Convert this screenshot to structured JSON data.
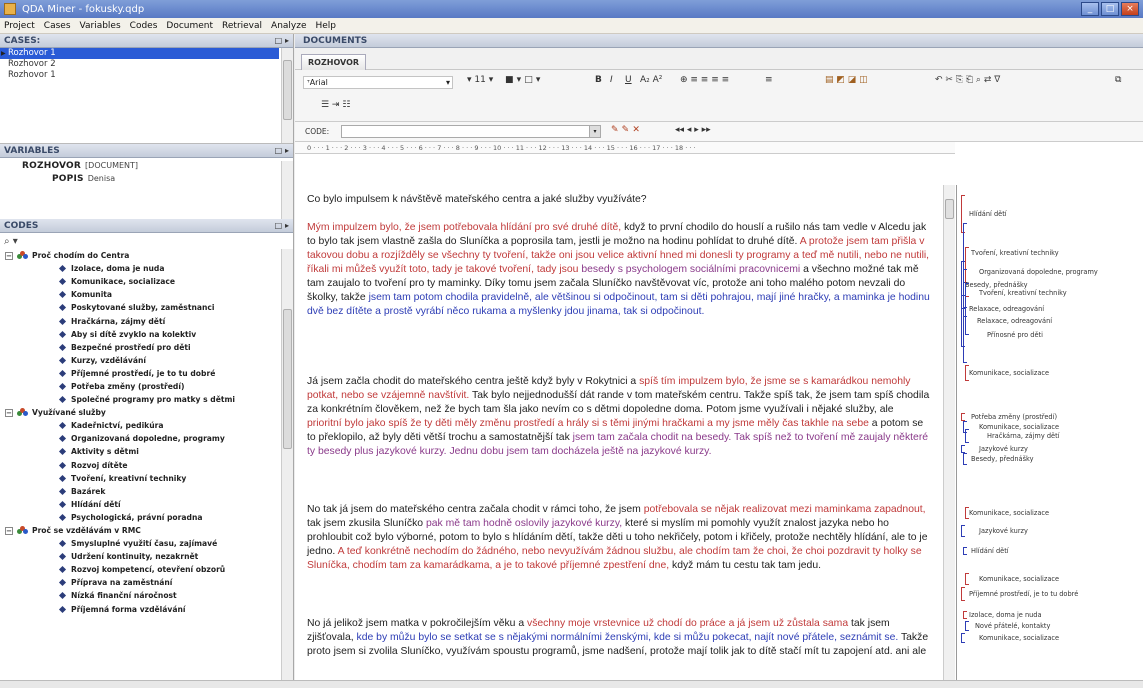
{
  "window": {
    "title": "QDA Miner - fokusky.qdp"
  },
  "menu": [
    "Project",
    "Cases",
    "Variables",
    "Codes",
    "Document",
    "Retrieval",
    "Analyze",
    "Help"
  ],
  "cases": {
    "header": "CASES:",
    "pin": "□ ▸",
    "items": [
      "Rozhovor 1",
      "Rozhovor 2",
      "Rozhovor 1"
    ]
  },
  "variables": {
    "header": "VARIABLES",
    "pin": "□ ▸",
    "rows": [
      {
        "name": "ROZHOVOR",
        "value": "[DOCUMENT]"
      },
      {
        "name": "POPIS",
        "value": "Denisa"
      }
    ]
  },
  "codes": {
    "header": "CODES",
    "pin": "□ ▸",
    "search_icon": "⌕ ▾",
    "groups": [
      {
        "label": "Proč chodím do Centra",
        "children": [
          "Izolace, doma je nuda",
          "Komunikace, socializace",
          "Komunita",
          "Poskytované služby, zaměstnanci",
          "Hračkárna, zájmy dětí",
          "Aby si dítě zvyklo na kolektiv",
          "Bezpečné prostředí pro děti",
          "Kurzy, vzdělávání",
          "Příjemné prostředí, je to tu dobré",
          "Potřeba změny (prostředí)",
          "Společné programy pro matky s dětmi"
        ]
      },
      {
        "label": "Využívané služby",
        "children": [
          "Kadeřnictví, pedikúra",
          "Organizovaná dopoledne, programy",
          "Aktivity s dětmi",
          "Rozvoj dítěte",
          "Tvoření, kreativní techniky",
          "Bazárek",
          "Hlídání dětí",
          "Psychologická, právní poradna"
        ]
      },
      {
        "label": "Proč se vzdělávám v RMC",
        "children": [
          "Smysluplné využití času, zajímavé",
          "Udržení kontinuity, nezakrnět",
          "Rozvoj kompetencí, otevření obzorů",
          "Příprava na zaměstnání",
          "Nízká finanční náročnost",
          "Příjemná forma vzdělávání"
        ]
      }
    ]
  },
  "documents": {
    "header": "DOCUMENTS",
    "tab": "ROZHOVOR",
    "font": "Arial",
    "font_size": "11",
    "code_label": "CODE:",
    "ruler": "0 · · · 1 · · · 2 · · · 3 · · · 4 · · · 5 · · · 6 · · · 7 · · · 8 · · · 9 · · · 10 · · · 11 · · · 12 · · · 13 · · · 14 · · · 15 · · · 16 · · · 17 · · · 18 · · ·"
  },
  "text": {
    "q": "Co bylo impulsem k návštěvě mateřského centra a jaké služby využíváte?",
    "p1a": "Mým impulzem bylo, že jsem potřebovala hlídání pro své druhé dítě,",
    "p1b": " když to první chodilo do houslí a rušilo nás tam vedle v Alcedu jak to bylo tak jsem vlastně zašla do Sluníčka a poprosila tam, jestli je možno na hodinu pohlídat to druhé dítě. ",
    "p1c": "A protože jsem tam přišla v takovou dobu a rozjížděly se všechny ty tvoření, takže oni jsou velice aktivní hned mi donesli ty programy a teď mě nutili, nebo ne nutili, říkali mi můžeš využít toto, tady je takové tvoření, tady jsou",
    "p1d": " besedy s psychologem sociálními pracovnicemi",
    "p1e": " a všechno možné tak mě tam zaujalo to tvoření pro ty maminky. Díky tomu jsem začala Sluníčko navštěvovat víc, protože ani toho malého potom nevzali do školky, takže ",
    "p1f": "jsem tam potom chodila pravidelně, ale většinou si odpočinout, tam si děti pohrajou, mají jiné hračky, a maminka je hodinu dvě bez dítěte a prostě vyrábí něco rukama a myšlenky jdou jinama, tak si odpočinout.",
    "p2a": "Já jsem začla chodit do mateřského centra ještě když byly v Rokytnici a ",
    "p2b": "spíš tím impulzem bylo, že jsme se s kamarádkou nemohly potkat, nebo se vzájemně navštívit.",
    "p2c": " Tak bylo nejjednodušší dát rande v tom mateřském centru. Takže spíš tak, že jsem tam spíš chodila za konkrétním člověkem, než že bych tam šla jako nevím co s dětmi dopoledne doma. Potom jsme využívali i nějaké služby, ale ",
    "p2d": "prioritní bylo jako spíš že ty děti měly změnu prostředí a hrály si s těmi jinými hračkami a my jsme měly čas takhle na sebe",
    "p2e": " a potom se to překlopilo, až byly děti větší trochu a samostatnější tak ",
    "p2f": "jsem tam začala chodit na besedy. Tak spíš než to tvoření mě zaujaly některé ty besedy plus jazykové kurzy. Jednu dobu jsem tam docházela ještě na jazykové kurzy.",
    "p3a": "No tak já jsem do mateřského centra začala chodit v rámci toho, že jsem ",
    "p3b": "potřebovala se nějak realizovat mezi maminkama zapadnout,",
    "p3c": " tak jsem zkusila Sluníčko ",
    "p3d": "pak mě tam hodně oslovily jazykové kurzy,",
    "p3e": " které si myslím mi pomohly využít znalost jazyka nebo ho prohloubit což bylo výborné, potom to bylo s hlídáním dětí, takže děti u toho nekřičely, potom i křičely, protože nechtěly hlídání, ale to je jedno. ",
    "p3f": "A teď konkrétně nechodím do žádného, nebo nevyužívám žádnou službu, ale chodím tam že choi, že choi pozdravit ty holky se Sluníčka, chodím tam za kamarádkama, a je to takové příjemné zpestření dne,",
    "p3g": " když mám tu cestu tak tam jedu.",
    "p4a": "No já jelikož jsem matka v pokročilejším věku a ",
    "p4b": "všechny moje vrstevnice už chodí do práce a já jsem už zůstala sama",
    "p4c": " tak jsem zjišťovala, ",
    "p4d": "kde by můžu bylo se setkat se s nějakými normálními ženskými, kde si můžu pokecat, najít nové přátele, seznámit se.",
    "p4e": " Takže proto jsem si zvolila Sluníčko, využívám spoustu programů, jsme nadšení, protože mají tolik jak to dítě stačí mít tu zapojení atd. ani ale"
  },
  "annotations": [
    "Hlídání dětí",
    "Tvoření, kreativní techniky",
    "Organizovaná dopoledne, programy",
    "Besedy, přednášky",
    "Tvoření, kreativní techniky",
    "Relaxace, odreagování",
    "Relaxace, odreagování",
    "Přínosné pro děti",
    "Komunikace, socializace",
    "Potřeba změny (prostředí)",
    "Komunikace, socializace",
    "Hračkárna, zájmy dětí",
    "Jazykové kurzy",
    "Besedy, přednášky",
    "Komunikace, socializace",
    "Jazykové kurzy",
    "Hlídání dětí",
    "Komunikace, socializace",
    "Příjemné prostředí, je to tu dobré",
    "Izolace, doma je nuda",
    "Nové přátelé, kontakty",
    "Komunikace, socializace"
  ]
}
